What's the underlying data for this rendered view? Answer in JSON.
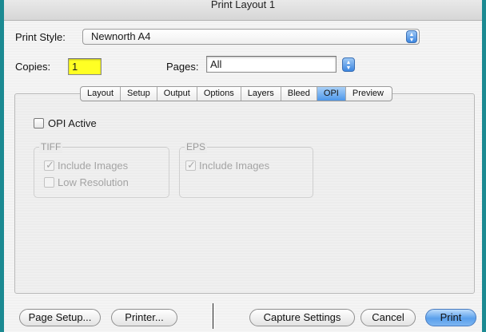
{
  "window": {
    "title": "Print Layout 1"
  },
  "print_style": {
    "label": "Print Style:",
    "value": "Newnorth A4"
  },
  "copies": {
    "label": "Copies:",
    "value": "1"
  },
  "pages": {
    "label": "Pages:",
    "value": "All"
  },
  "tabs": [
    {
      "label": "Layout",
      "active": false
    },
    {
      "label": "Setup",
      "active": false
    },
    {
      "label": "Output",
      "active": false
    },
    {
      "label": "Options",
      "active": false
    },
    {
      "label": "Layers",
      "active": false
    },
    {
      "label": "Bleed",
      "active": false
    },
    {
      "label": "OPI",
      "active": true
    },
    {
      "label": "Preview",
      "active": false
    }
  ],
  "opi": {
    "opi_active_label": "OPI Active",
    "opi_active_checked": false,
    "tiff": {
      "title": "TIFF",
      "include_images_label": "Include Images",
      "include_images_checked": true,
      "low_resolution_label": "Low Resolution",
      "low_resolution_checked": false
    },
    "eps": {
      "title": "EPS",
      "include_images_label": "Include Images",
      "include_images_checked": true
    }
  },
  "buttons": {
    "page_setup": "Page Setup...",
    "printer": "Printer...",
    "capture_settings": "Capture Settings",
    "cancel": "Cancel",
    "print": "Print"
  },
  "colors": {
    "desktop": "#1b8a92",
    "copies_highlight": "#ffff24",
    "default_button": "#5aa0ec"
  }
}
